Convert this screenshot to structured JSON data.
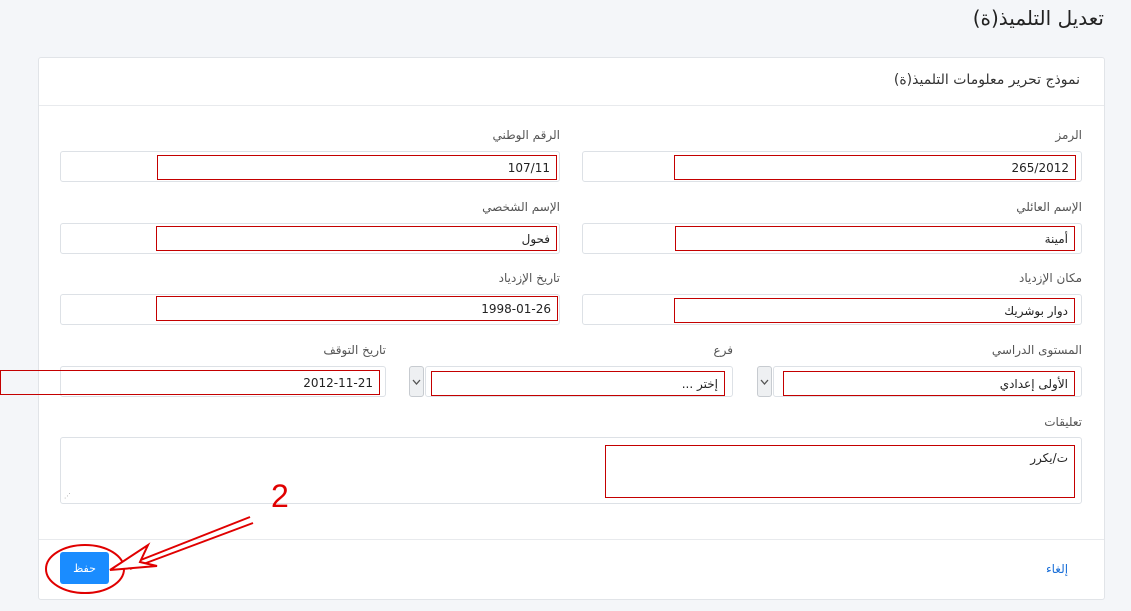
{
  "page": {
    "title": "تعديل التلميذ(ة)"
  },
  "card": {
    "header_title": "نموذج تحرير معلومات التلميذ(ة)"
  },
  "form": {
    "code": {
      "label": "الرمز",
      "value": "265/2012"
    },
    "national_id": {
      "label": "الرقم الوطني",
      "value": "107/11"
    },
    "last_name": {
      "label": "الإسم العائلي",
      "value": "أمينة"
    },
    "first_name": {
      "label": "الإسم الشخصي",
      "value": "فحول"
    },
    "birth_place": {
      "label": "مكان الإزدياد",
      "value": "دوار بوشريك"
    },
    "birth_date": {
      "label": "تاريخ الإزدياد",
      "value": "1998-01-26"
    },
    "level": {
      "label": "المستوى الدراسي",
      "value": "الأولى إعدادي"
    },
    "branch": {
      "label": "فرع",
      "value": "إختر ..."
    },
    "stop_date": {
      "label": "تاريخ التوقف",
      "value": "2012-11-21"
    },
    "comments": {
      "label": "تعليقات",
      "value": "ت/يكرر"
    }
  },
  "actions": {
    "save_label": "حفظ",
    "cancel_label": "إلغاء"
  },
  "annotation": {
    "step_number": "2",
    "color": "#e00000"
  },
  "colors": {
    "accent": "#1a8cff",
    "highlight_border": "#c40000"
  },
  "icons": {
    "select_toggle": "chevron-down-icon",
    "resize": "resize-grip-icon"
  }
}
